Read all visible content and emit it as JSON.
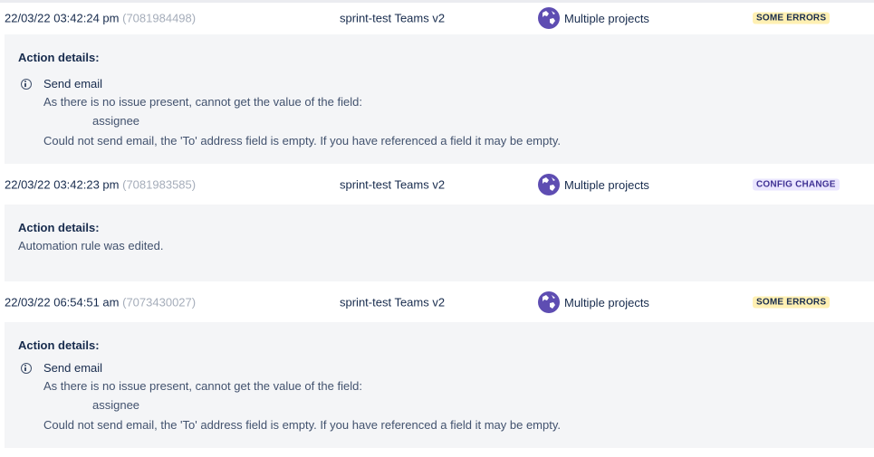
{
  "entries": [
    {
      "date": "22/03/22 03:42:24 pm",
      "exec_id": "(7081984498)",
      "rule": "sprint-test Teams v2",
      "project": "Multiple projects",
      "status": "SOME ERRORS",
      "details_title": "Action details:",
      "action": "Send email",
      "msg1": "As there is no issue present, cannot get the value of the field:",
      "field": "assignee",
      "msg2": "Could not send email, the 'To' address field is empty. If you have referenced a field it may be empty."
    },
    {
      "date": "22/03/22 03:42:23 pm",
      "exec_id": "(7081983585)",
      "rule": "sprint-test Teams v2",
      "project": "Multiple projects",
      "status": "CONFIG CHANGE",
      "details_title": "Action details:",
      "message": "Automation rule was edited."
    },
    {
      "date": "22/03/22 06:54:51 am",
      "exec_id": "(7073430027)",
      "rule": "sprint-test Teams v2",
      "project": "Multiple projects",
      "status": "SOME ERRORS",
      "details_title": "Action details:",
      "action": "Send email",
      "msg1": "As there is no issue present, cannot get the value of the field:",
      "field": "assignee",
      "msg2": "Could not send email, the 'To' address field is empty. If you have referenced a field it may be empty."
    }
  ],
  "icons": {
    "project": "globe-icon",
    "info": "info-icon"
  },
  "colors": {
    "some_errors_bg": "#fff0b3",
    "config_change_bg": "#eae6ff",
    "config_change_fg": "#403294",
    "exec_id": "#a5adba",
    "globe": "#5e4db2"
  }
}
